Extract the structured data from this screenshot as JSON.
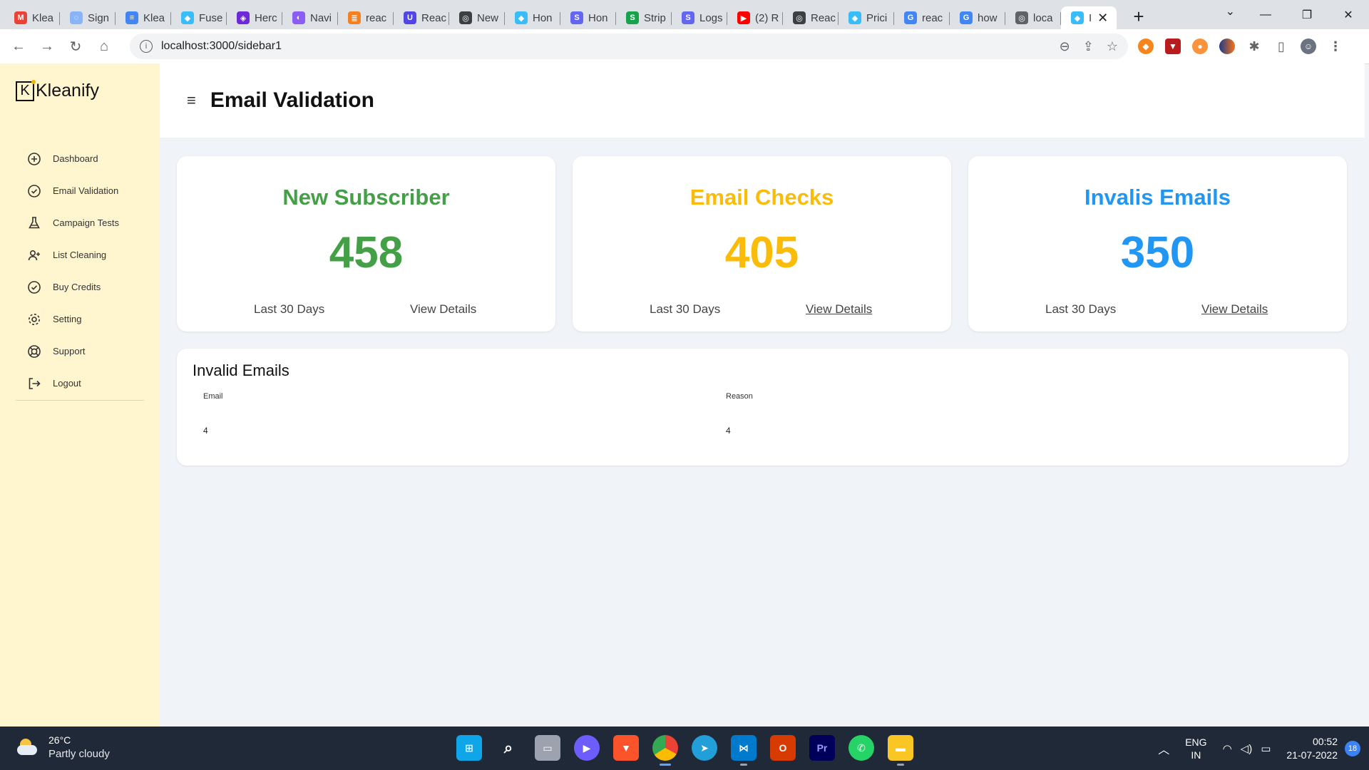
{
  "browser": {
    "tabs": [
      {
        "label": "Klea",
        "favicon_color": "#ea4335",
        "favicon_glyph": "M",
        "icon": "gmail-icon"
      },
      {
        "label": "Sign",
        "favicon_color": "#8ab4f8",
        "favicon_glyph": "◌",
        "icon": "loading-icon"
      },
      {
        "label": "Klea",
        "favicon_color": "#4285f4",
        "favicon_glyph": "≡",
        "icon": "docs-icon"
      },
      {
        "label": "Fuse",
        "favicon_color": "#38bdf8",
        "favicon_glyph": "◆",
        "icon": "fuse-icon"
      },
      {
        "label": "Herc",
        "favicon_color": "#6d28d9",
        "favicon_glyph": "◈",
        "icon": "hercules-icon"
      },
      {
        "label": "Navi",
        "favicon_color": "#8b5cf6",
        "favicon_glyph": "◐",
        "icon": "navi-icon"
      },
      {
        "label": "reac",
        "favicon_color": "#f48024",
        "favicon_glyph": "≣",
        "icon": "stackoverflow-icon"
      },
      {
        "label": "Reac",
        "favicon_color": "#4f46e5",
        "favicon_glyph": "U",
        "icon": "ui-library-icon"
      },
      {
        "label": "New",
        "favicon_color": "#3c4043",
        "favicon_glyph": "◎",
        "icon": "github-icon"
      },
      {
        "label": "Hon",
        "favicon_color": "#38bdf8",
        "favicon_glyph": "◆",
        "icon": "home-icon"
      },
      {
        "label": "Hon",
        "favicon_color": "#6366f1",
        "favicon_glyph": "S",
        "icon": "stripe-icon"
      },
      {
        "label": "Strip",
        "favicon_color": "#16a34a",
        "favicon_glyph": "S",
        "icon": "stripe-green-icon"
      },
      {
        "label": "Logs",
        "favicon_color": "#6366f1",
        "favicon_glyph": "S",
        "icon": "logs-icon"
      },
      {
        "label": "(2) R",
        "favicon_color": "#ff0000",
        "favicon_glyph": "▶",
        "icon": "youtube-icon"
      },
      {
        "label": "Reac",
        "favicon_color": "#3c4043",
        "favicon_glyph": "◎",
        "icon": "globe-icon"
      },
      {
        "label": "Prici",
        "favicon_color": "#38bdf8",
        "favicon_glyph": "◆",
        "icon": "pricing-icon"
      },
      {
        "label": "reac",
        "favicon_color": "#4285f4",
        "favicon_glyph": "G",
        "icon": "google-icon"
      },
      {
        "label": "how",
        "favicon_color": "#4285f4",
        "favicon_glyph": "G",
        "icon": "google-icon"
      },
      {
        "label": "loca",
        "favicon_color": "#5f6368",
        "favicon_glyph": "◎",
        "icon": "globe-icon"
      }
    ],
    "active_tab": {
      "label": "I",
      "favicon_color": "#38bdf8",
      "favicon_glyph": "◆"
    },
    "url": "localhost:3000/sidebar1"
  },
  "app": {
    "brand": "Kleanify",
    "brand_letter": "K",
    "nav": [
      {
        "label": "Dashboard",
        "icon": "plus-circle-icon"
      },
      {
        "label": "Email Validation",
        "icon": "check-circle-icon"
      },
      {
        "label": "Campaign Tests",
        "icon": "flask-icon"
      },
      {
        "label": "List Cleaning",
        "icon": "user-plus-icon"
      },
      {
        "label": "Buy Credits",
        "icon": "check-circle-icon"
      },
      {
        "label": "Setting",
        "icon": "gear-icon"
      },
      {
        "label": "Support",
        "icon": "lifebuoy-icon"
      },
      {
        "label": "Logout",
        "icon": "logout-icon"
      }
    ],
    "page_title": "Email Validation",
    "cards": [
      {
        "title": "New Subscriber",
        "value": "458",
        "period": "Last 30 Days",
        "details": "View Details",
        "color": "#43a047",
        "underlined": false
      },
      {
        "title": "Email Checks",
        "value": "405",
        "period": "Last 30 Days",
        "details": "View Details",
        "color": "#fbbc09",
        "underlined": true
      },
      {
        "title": "Invalis Emails",
        "value": "350",
        "period": "Last 30 Days",
        "details": "View Details",
        "color": "#2196f3",
        "underlined": true
      }
    ],
    "table": {
      "title": "Invalid Emails",
      "columns": [
        "Email",
        "Reason"
      ],
      "rows": [
        [
          "4",
          "4"
        ]
      ]
    }
  },
  "taskbar": {
    "temperature": "26°C",
    "condition": "Partly cloudy",
    "language": "ENG",
    "region": "IN",
    "time": "00:52",
    "date": "21-07-2022",
    "notifications": "18"
  }
}
